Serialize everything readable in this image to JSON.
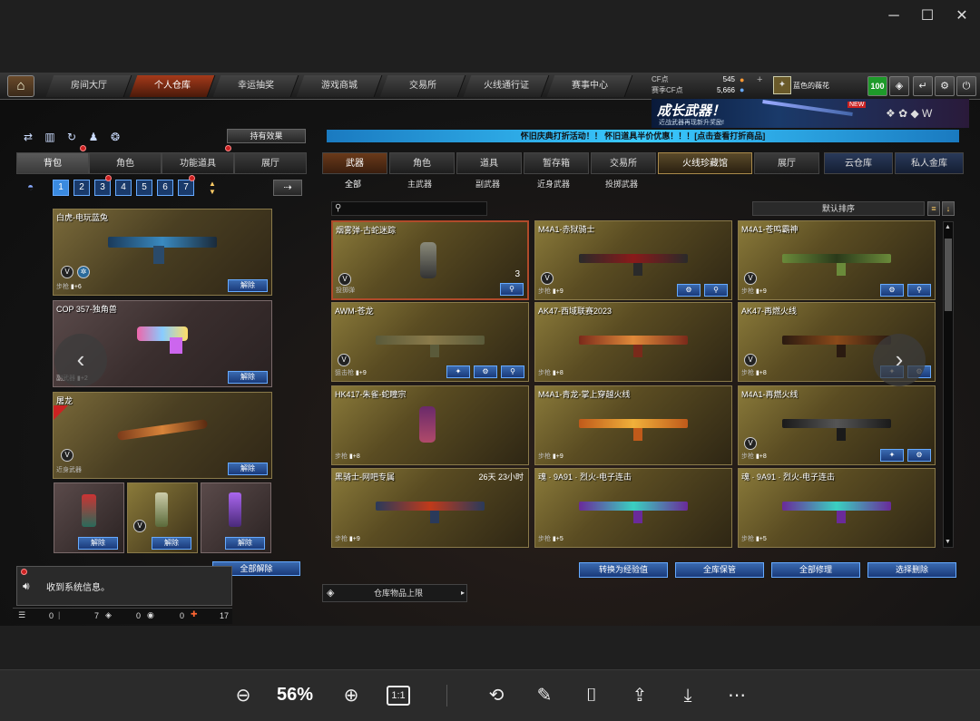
{
  "nav": {
    "tabs": [
      "房间大厅",
      "个人仓库",
      "幸运抽奖",
      "游戏商城",
      "交易所",
      "火线通行证",
      "赛事中心"
    ],
    "active_index": 1
  },
  "points": {
    "cf_label": "CF点",
    "cf_value": "545",
    "arena_label": "赛季CF点",
    "arena_value": "5,666"
  },
  "user": {
    "name": "蓝色的薇花",
    "level": "100"
  },
  "left": {
    "effects_button": "持有效果",
    "tabs": [
      "背包",
      "角色",
      "功能道具",
      "展厅"
    ],
    "pages": [
      "1",
      "2",
      "3",
      "4",
      "5",
      "6",
      "7"
    ],
    "cards": [
      {
        "title": "白虎-电玩蓝兔",
        "tag": "步枪",
        "bonus": "+6"
      },
      {
        "title": "COP 357-独角兽",
        "tag": "副武器",
        "bonus": "+2"
      },
      {
        "title": "屠龙",
        "tag": "近身武器",
        "bonus": ""
      }
    ],
    "unequip": "解除",
    "unequip_all": "全部解除",
    "system_message": "收到系统信息。",
    "status": [
      "0",
      "7",
      "0",
      "0",
      "17"
    ]
  },
  "right": {
    "notice": "怀旧庆典打折活动！！ 怀旧道具半价优惠！！！[点击查看打折商品]",
    "banner_title": "成长武器！",
    "banner_sub": "近战武器再现新升奖励!",
    "banner_new": "NEW",
    "tabs": [
      "武器",
      "角色",
      "道具",
      "暂存箱",
      "交易所",
      "火线珍藏馆",
      "展厅"
    ],
    "active_tab": 5,
    "storage_tabs": [
      "云仓库",
      "私人金库"
    ],
    "sub_tabs": [
      "全部",
      "主武器",
      "副武器",
      "近身武器",
      "投掷武器"
    ],
    "sort_label": "默认排序",
    "items": [
      {
        "title": "烟雾弹-古蛇迷踪",
        "tag": "投掷弹",
        "count": "3",
        "time": ""
      },
      {
        "title": "M4A1-赤狱骑士",
        "tag": "步枪",
        "bonus": "+9",
        "time": ""
      },
      {
        "title": "M4A1-苍鸣霸神",
        "tag": "步枪",
        "bonus": "+9",
        "time": ""
      },
      {
        "title": "AWM-苍龙",
        "tag": "狙击枪",
        "bonus": "+9",
        "time": ""
      },
      {
        "title": "AK47-西域联赛2023",
        "tag": "步枪",
        "bonus": "+8",
        "time": ""
      },
      {
        "title": "AK47-再燃火线",
        "tag": "步枪",
        "bonus": "+8",
        "time": ""
      },
      {
        "title": "HK417-朱雀-蛇瞳宗",
        "tag": "步枪",
        "bonus": "+8",
        "time": ""
      },
      {
        "title": "M4A1-青龙-掌上穿越火线",
        "tag": "步枪",
        "bonus": "+9",
        "time": ""
      },
      {
        "title": "M4A1-再燃火线",
        "tag": "步枪",
        "bonus": "+8",
        "time": ""
      },
      {
        "title": "黑骑士-网吧专属",
        "tag": "步枪",
        "bonus": "+9",
        "time": "26天 23小时"
      },
      {
        "title": "魂 · 9A91 · 烈火-电子连击",
        "tag": "步枪",
        "bonus": "+5",
        "time": ""
      },
      {
        "title": "魂 · 9A91 · 烈火-电子连击",
        "tag": "步枪",
        "bonus": "+5",
        "time": ""
      }
    ],
    "actions": [
      "转换为经验值",
      "全库保管",
      "全部修理",
      "选择删除"
    ],
    "storage_limit": "仓库物品上限"
  },
  "viewer": {
    "zoom": "56%",
    "actual_size": "1:1"
  },
  "colors": {
    "accent": "#3a8ae0",
    "nav_active": "#a53a1a",
    "card_gold": "#8a7a3a"
  }
}
